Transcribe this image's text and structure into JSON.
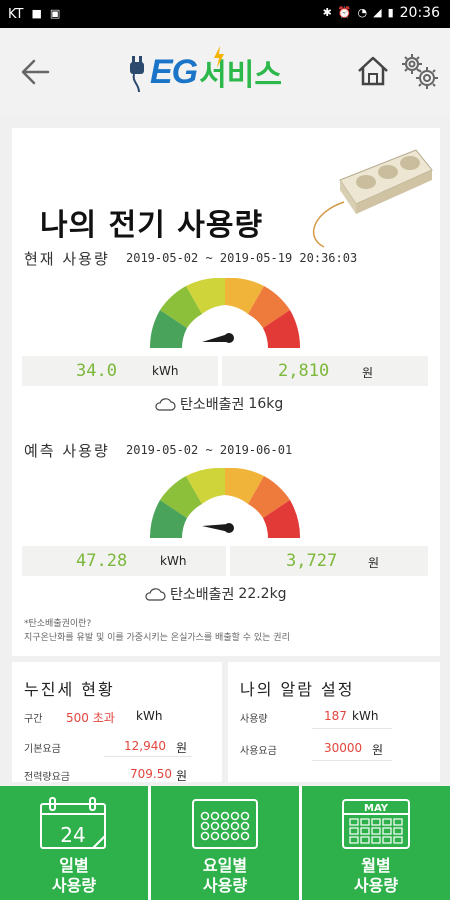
{
  "status_bar": {
    "carrier": "KT",
    "time": "20:36"
  },
  "header": {
    "logo_prefix": "EG",
    "logo_suffix": "서비스"
  },
  "main": {
    "title": "나의 전기 사용량",
    "current": {
      "label": "현재 사용량",
      "range": "2019-05-02 ~ 2019-05-19 20:36:03",
      "kwh": "34.0",
      "kwh_unit": "kWh",
      "won": "2,810",
      "won_unit": "원",
      "carbon_label": "탄소배출권",
      "carbon_value": "16kg"
    },
    "forecast": {
      "label": "예측 사용량",
      "range": "2019-05-02 ~ 2019-06-01",
      "kwh": "47.28",
      "kwh_unit": "kWh",
      "won": "3,727",
      "won_unit": "원",
      "carbon_label": "탄소배출권",
      "carbon_value": "22.2kg"
    },
    "note_title": "*탄소배출권이란?",
    "note_body": "지구온난화를 유발 및 이를 가중시키는 온실가스를 배출할 수 있는 권리"
  },
  "progressive": {
    "title": "누진세 현황",
    "section_key": "구간",
    "section_value": "500 초과",
    "section_unit": "kWh",
    "base_key": "기본요금",
    "base_value": "12,940",
    "base_unit": "원",
    "energy_key": "전력량요금",
    "energy_value": "709.50",
    "energy_unit": "원"
  },
  "alarm": {
    "title": "나의 알람 설정",
    "usage_key": "사용량",
    "usage_value": "187",
    "usage_unit": "kWh",
    "fee_key": "사용요금",
    "fee_value": "30000",
    "fee_unit": "원"
  },
  "nav": {
    "daily_icon_text": "24",
    "daily_line1": "일별",
    "daily_line2": "사용량",
    "weekday_line1": "요일별",
    "weekday_line2": "사용량",
    "monthly_icon_text": "MAY",
    "monthly_line1": "월별",
    "monthly_line2": "사용량"
  },
  "colors": {
    "brand_green": "#2eb14a",
    "value_green": "#7cb83a",
    "alert_red": "#e2463d",
    "logo_blue": "#1a75c8"
  },
  "icons": [
    "back-arrow-icon",
    "home-icon",
    "settings-gears-icon",
    "cloud-icon",
    "calendar-icon",
    "weekday-calendar-icon",
    "monthly-calendar-icon"
  ]
}
